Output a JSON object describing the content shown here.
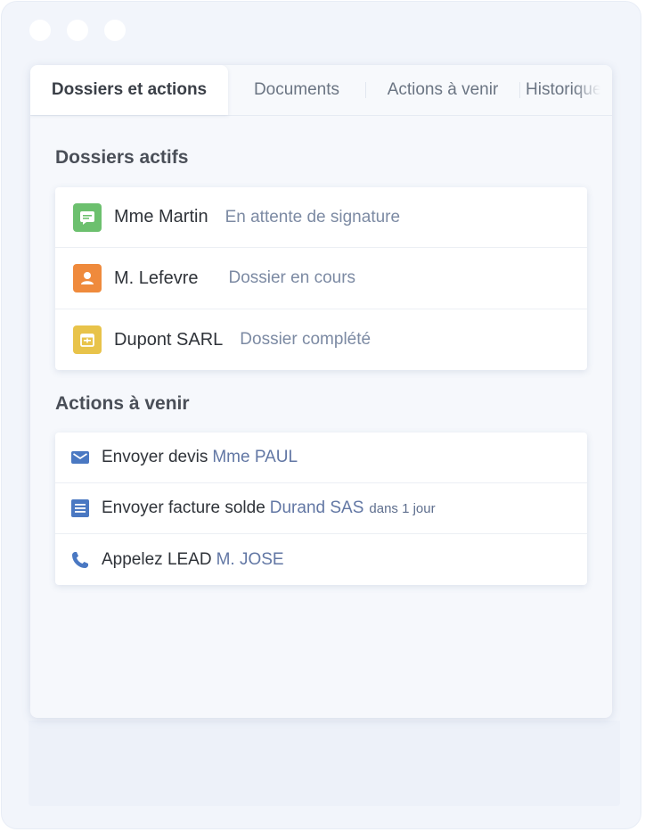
{
  "tabs": [
    {
      "label": "Dossiers et actions",
      "active": true
    },
    {
      "label": "Documents",
      "active": false
    },
    {
      "label": "Actions à venir",
      "active": false
    },
    {
      "label": "Historique",
      "active": false
    }
  ],
  "dossiers": {
    "title": "Dossiers actifs",
    "items": [
      {
        "name": "Mme Martin",
        "status": "En attente de signature",
        "icon": "message-icon",
        "color": "#6cc06e"
      },
      {
        "name": "M. Lefevre",
        "status": "Dossier en cours",
        "icon": "user-icon",
        "color": "#ef8a3c"
      },
      {
        "name": "Dupont SARL",
        "status": "Dossier complété",
        "icon": "calendar-icon",
        "color": "#e8c34a"
      }
    ]
  },
  "actions": {
    "title": "Actions à venir",
    "items": [
      {
        "label": "Envoyer devis",
        "who": "Mme PAUL",
        "when": "",
        "icon": "mail-icon"
      },
      {
        "label": "Envoyer facture solde",
        "who": "Durand SAS",
        "when": "dans 1 jour",
        "icon": "document-icon"
      },
      {
        "label": "Appelez LEAD",
        "who": "M. JOSE",
        "when": "",
        "icon": "phone-icon"
      }
    ]
  },
  "colors": {
    "accent": "#4a78c2",
    "status_text": "#7c8aa3"
  }
}
